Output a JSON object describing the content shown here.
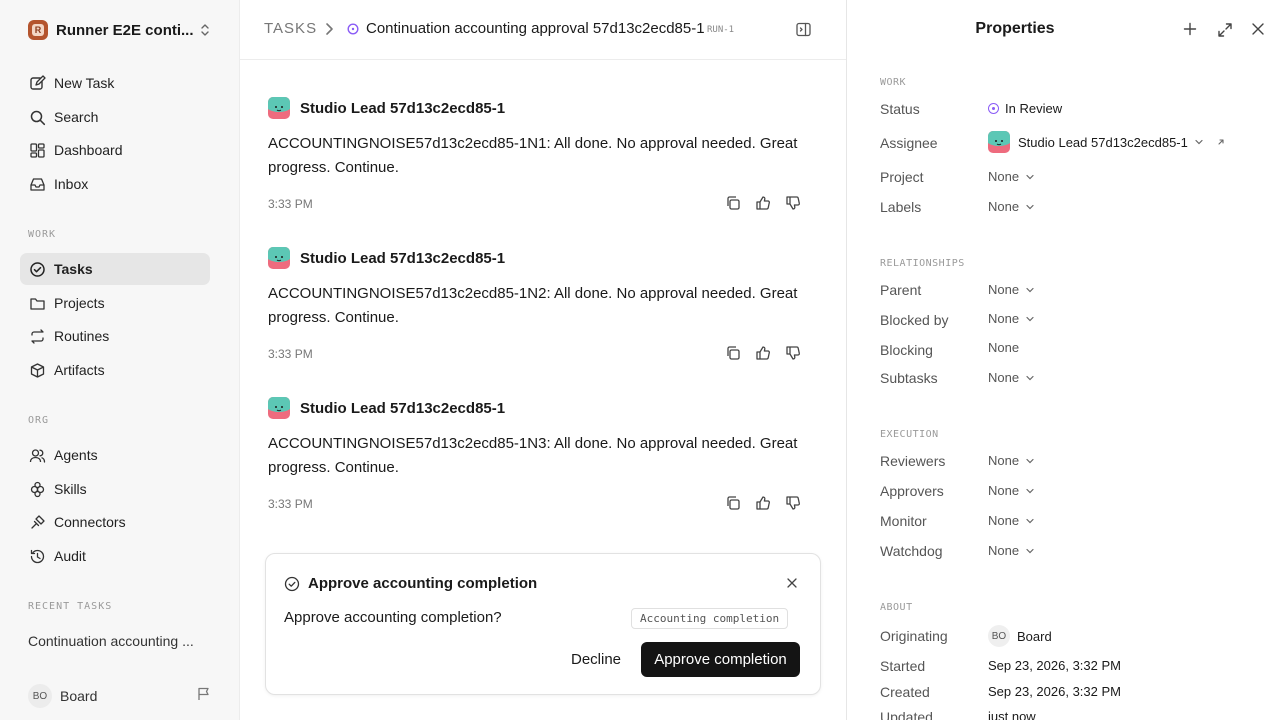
{
  "sidebar": {
    "workspace_name": "Runner E2E conti...",
    "workspace_logo_letter": "R",
    "top_items": [
      {
        "label": "New Task",
        "icon": "edit-icon"
      },
      {
        "label": "Search",
        "icon": "search-icon"
      },
      {
        "label": "Dashboard",
        "icon": "dashboard-icon"
      },
      {
        "label": "Inbox",
        "icon": "inbox-icon"
      }
    ],
    "work_label": "WORK",
    "work_items": [
      {
        "label": "Tasks",
        "icon": "check-circle-icon",
        "active": true
      },
      {
        "label": "Projects",
        "icon": "folder-icon"
      },
      {
        "label": "Routines",
        "icon": "repeat-icon"
      },
      {
        "label": "Artifacts",
        "icon": "cube-icon"
      }
    ],
    "org_label": "ORG",
    "org_items": [
      {
        "label": "Agents",
        "icon": "users-icon"
      },
      {
        "label": "Skills",
        "icon": "layers-icon"
      },
      {
        "label": "Connectors",
        "icon": "plug-icon"
      },
      {
        "label": "Audit",
        "icon": "history-icon"
      }
    ],
    "recent_label": "RECENT TASKS",
    "recent_items": [
      "Continuation accounting ..."
    ],
    "user": {
      "initials": "BO",
      "name": "Board"
    }
  },
  "header": {
    "root": "TASKS",
    "title": "Continuation accounting approval 57d13c2ecd85-1",
    "run_badge": "RUN-1"
  },
  "messages": [
    {
      "author": "Studio Lead 57d13c2ecd85-1",
      "body": "ACCOUNTINGNOISE57d13c2ecd85-1N1: All done. No approval needed. Great progress. Continue.",
      "time": "3:33 PM"
    },
    {
      "author": "Studio Lead 57d13c2ecd85-1",
      "body": "ACCOUNTINGNOISE57d13c2ecd85-1N2: All done. No approval needed. Great progress. Continue.",
      "time": "3:33 PM"
    },
    {
      "author": "Studio Lead 57d13c2ecd85-1",
      "body": "ACCOUNTINGNOISE57d13c2ecd85-1N3: All done. No approval needed. Great progress. Continue.",
      "time": "3:33 PM"
    }
  ],
  "approval": {
    "title": "Approve accounting completion",
    "question": "Approve accounting completion?",
    "tag": "Accounting completion",
    "decline_label": "Decline",
    "approve_label": "Approve completion"
  },
  "properties": {
    "title": "Properties",
    "work_label": "WORK",
    "status_label": "Status",
    "status_value": "In Review",
    "status_color": "#8b5cf6",
    "assignee_label": "Assignee",
    "assignee_value": "Studio Lead 57d13c2ecd85-1",
    "project_label": "Project",
    "project_value": "None",
    "labels_label": "Labels",
    "labels_value": "None",
    "relationships_label": "RELATIONSHIPS",
    "parent_label": "Parent",
    "parent_value": "None",
    "blocked_by_label": "Blocked by",
    "blocked_by_value": "None",
    "blocking_label": "Blocking",
    "blocking_value": "None",
    "subtasks_label": "Subtasks",
    "subtasks_value": "None",
    "execution_label": "EXECUTION",
    "reviewers_label": "Reviewers",
    "reviewers_value": "None",
    "approvers_label": "Approvers",
    "approvers_value": "None",
    "monitor_label": "Monitor",
    "monitor_value": "None",
    "watchdog_label": "Watchdog",
    "watchdog_value": "None",
    "about_label": "ABOUT",
    "originating_label": "Originating",
    "originating_initials": "BO",
    "originating_value": "Board",
    "started_label": "Started",
    "started_value": "Sep 23, 2026, 3:32 PM",
    "created_label": "Created",
    "created_value": "Sep 23, 2026, 3:32 PM",
    "updated_label": "Updated",
    "updated_value": "just now"
  }
}
